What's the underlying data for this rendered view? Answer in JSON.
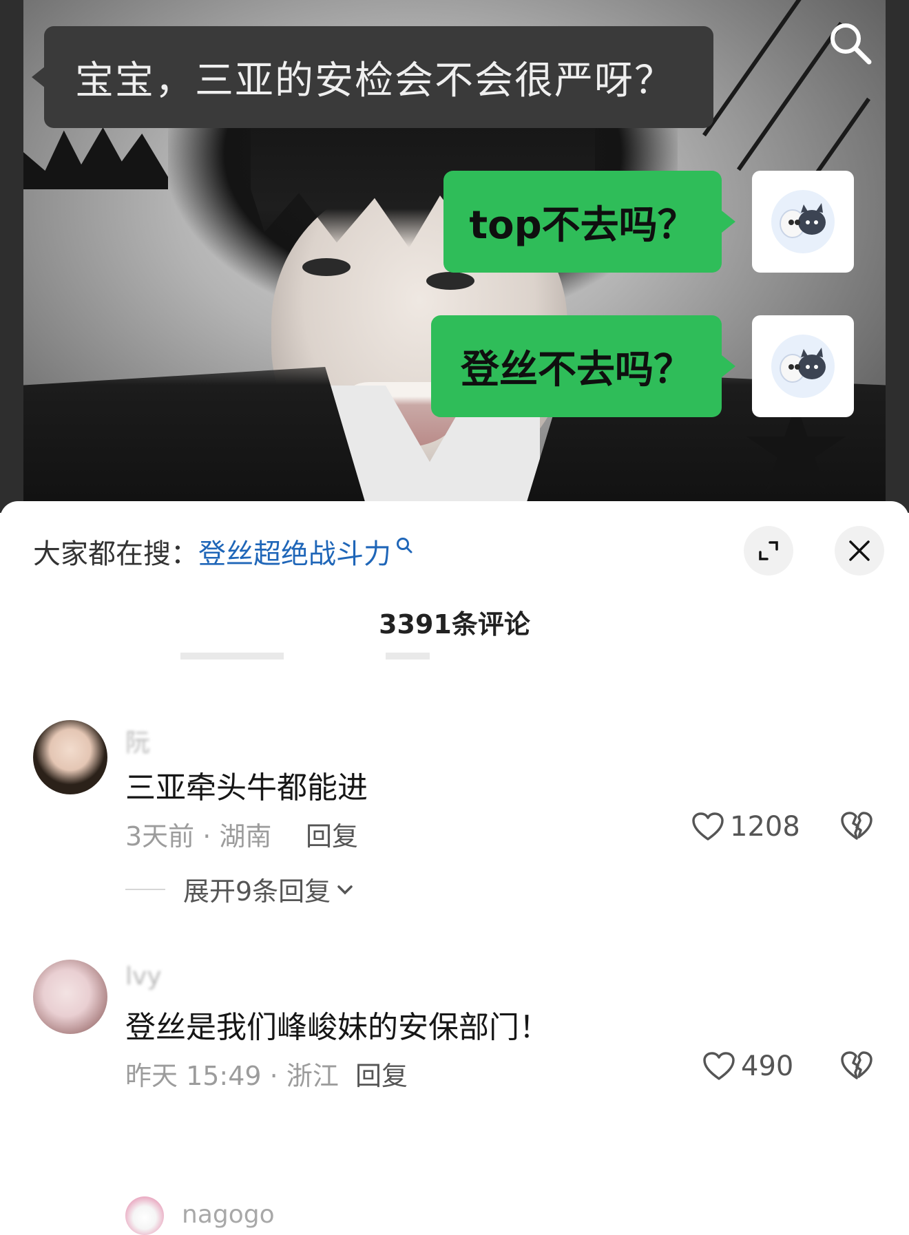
{
  "video": {
    "top_message": "宝宝，三亚的安检会不会很严呀？",
    "reply_1": "top不去吗？",
    "reply_2": "登丝不去吗？"
  },
  "search": {
    "trending_prefix": "大家都在搜：",
    "trending_keyword": "登丝超绝战斗力"
  },
  "comments_header": {
    "count_label": "3391条评论"
  },
  "comments": [
    {
      "username": "阮",
      "text": "三亚牵头牛都能进",
      "meta": "3天前 · 湖南",
      "reply_label": "回复",
      "likes": "1208",
      "expand_label": "展开9条回复"
    },
    {
      "username": "lvy",
      "text": "登丝是我们峰峻妹的安保部门！",
      "meta": "昨天 15:49 · 浙江",
      "reply_label": "回复",
      "likes": "490"
    },
    {
      "username": "nagogo"
    }
  ],
  "colors": {
    "bubble_green": "#2fbd59",
    "keyword_blue": "#1f66b8",
    "sheet_background": "#ffffff"
  },
  "icons": [
    "search-icon",
    "expand-icon",
    "close-icon",
    "heart-icon",
    "dislike-icon",
    "chevron-down-icon"
  ]
}
